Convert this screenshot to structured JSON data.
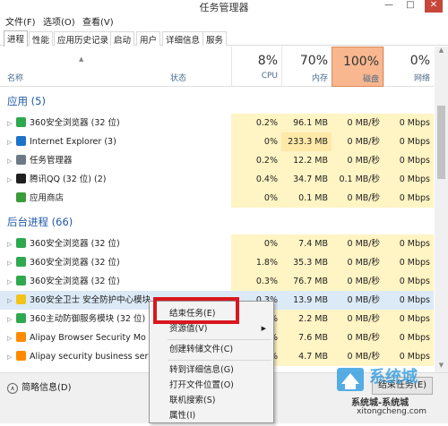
{
  "window": {
    "title": "任务管理器",
    "minimize": "—",
    "maximize": "□",
    "close": "✕"
  },
  "menu": [
    "文件(F)",
    "选项(O)",
    "查看(V)"
  ],
  "tabs": [
    "进程",
    "性能",
    "应用历史记录",
    "启动",
    "用户",
    "详细信息",
    "服务"
  ],
  "columns": {
    "name": "名称",
    "status": "状态",
    "cpu": {
      "pct": "8%",
      "label": "CPU"
    },
    "mem": {
      "pct": "70%",
      "label": "内存"
    },
    "disk": {
      "pct": "100%",
      "label": "磁盘"
    },
    "net": {
      "pct": "0%",
      "label": "网络"
    }
  },
  "groups": {
    "apps": "应用 (5)",
    "background": "后台进程 (66)"
  },
  "rows": [
    {
      "name": "360安全浏览器 (32 位)",
      "icon": "green",
      "cpu": "0.2%",
      "mem": "96.1 MB",
      "disk": "0 MB/秒",
      "net": "0 Mbps"
    },
    {
      "name": "Internet Explorer (3)",
      "icon": "blue",
      "cpu": "0%",
      "mem": "233.3 MB",
      "disk": "0 MB/秒",
      "net": "0 Mbps"
    },
    {
      "name": "任务管理器",
      "icon": "gray",
      "cpu": "0.2%",
      "mem": "12.2 MB",
      "disk": "0 MB/秒",
      "net": "0 Mbps"
    },
    {
      "name": "腾讯QQ (32 位) (2)",
      "icon": "qq",
      "cpu": "0.4%",
      "mem": "34.7 MB",
      "disk": "0.1 MB/秒",
      "net": "0 Mbps"
    },
    {
      "name": "应用商店",
      "icon": "store",
      "cpu": "0%",
      "mem": "0.1 MB",
      "disk": "0 MB/秒",
      "net": "0 Mbps"
    },
    {
      "name": "360安全浏览器 (32 位)",
      "icon": "green",
      "cpu": "0%",
      "mem": "7.4 MB",
      "disk": "0 MB/秒",
      "net": "0 Mbps"
    },
    {
      "name": "360安全浏览器 (32 位)",
      "icon": "green",
      "cpu": "1.8%",
      "mem": "35.3 MB",
      "disk": "0 MB/秒",
      "net": "0 Mbps"
    },
    {
      "name": "360安全浏览器 (32 位)",
      "icon": "green",
      "cpu": "0.3%",
      "mem": "76.7 MB",
      "disk": "0 MB/秒",
      "net": "0 Mbps"
    },
    {
      "name": "360安全卫士 安全防护中心模块",
      "icon": "shield",
      "cpu": "0.3%",
      "mem": "13.9 MB",
      "disk": "0 MB/秒",
      "net": "0 Mbps"
    },
    {
      "name": "360主动防御服务模块 (32 位)",
      "icon": "green",
      "cpu": "%",
      "mem": "2.2 MB",
      "disk": "0 MB/秒",
      "net": "0 Mbps"
    },
    {
      "name": "Alipay Browser Security Mo",
      "icon": "alipay",
      "cpu": "%",
      "mem": "7.6 MB",
      "disk": "0 MB/秒",
      "net": "0 Mbps"
    },
    {
      "name": "Alipay security business ser",
      "icon": "alipay",
      "cpu": "%",
      "mem": "4.7 MB",
      "disk": "0 MB/秒",
      "net": "0 Mbps"
    }
  ],
  "footer": {
    "fewer_details": "简略信息(D)",
    "end_task": "结束任务(E)"
  },
  "context_menu": [
    "结束任务(E)",
    "资源值(V)",
    "创建转储文件(C)",
    "转到详细信息(G)",
    "打开文件位置(O)",
    "联机搜索(S)",
    "属性(I)"
  ],
  "watermark": {
    "brand": "系统城",
    "line1": "系统城-系统城",
    "line2": "xitongcheng.com"
  },
  "colors": {
    "accent": "#1f58a8",
    "heat_light": "#fff4c4",
    "heat_med": "#ffe9a8",
    "disk_header": "#f8b78f",
    "selection": "#dceaf7",
    "highlight_box": "#d9171f"
  }
}
